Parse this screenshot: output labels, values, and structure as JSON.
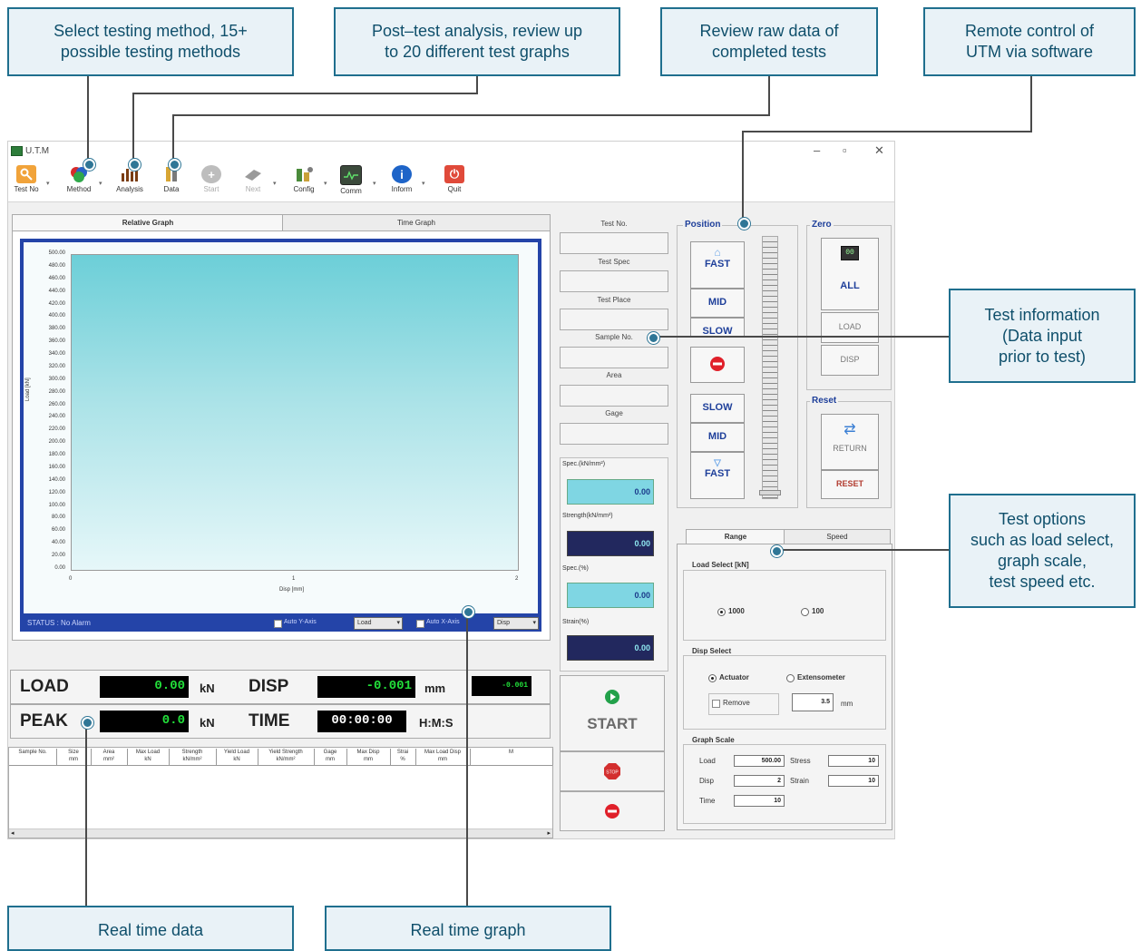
{
  "callouts": {
    "method": "Select testing method, 15+\npossible testing methods",
    "analysis": "Post–test analysis, review up\nto 20 different test graphs",
    "raw_data": "Review raw data of\ncompleted tests",
    "remote": "Remote control of\nUTM via software",
    "test_info": "Test information\n(Data input\nprior to test)",
    "test_options": "Test options\nsuch as load select,\ngraph scale,\ntest speed etc.",
    "realtime_data": "Real time data",
    "realtime_graph": "Real time graph"
  },
  "window": {
    "title": "U.T.M",
    "minimize": "–",
    "maximize": "▫",
    "close": "✕"
  },
  "toolbar": [
    {
      "label": "Test No",
      "icon": "key-icon"
    },
    {
      "label": "Method",
      "icon": "method-icon"
    },
    {
      "label": "Analysis",
      "icon": "bar-chart-icon"
    },
    {
      "label": "Data",
      "icon": "data-icon"
    },
    {
      "label": "Start",
      "icon": "plus-icon"
    },
    {
      "label": "Next",
      "icon": "arrow-icon"
    },
    {
      "label": "Config",
      "icon": "config-icon"
    },
    {
      "label": "Comm",
      "icon": "monitor-icon"
    },
    {
      "label": "Inform",
      "icon": "info-icon"
    },
    {
      "label": "Quit",
      "icon": "power-icon"
    }
  ],
  "tabs": {
    "relative": "Relative Graph",
    "time": "Time Graph"
  },
  "graph": {
    "y_axis_label": "Load [kN]",
    "x_axis_label": "Disp [mm]",
    "y_ticks": [
      "500.00",
      "480.00",
      "460.00",
      "440.00",
      "420.00",
      "400.00",
      "380.00",
      "360.00",
      "340.00",
      "320.00",
      "300.00",
      "280.00",
      "260.00",
      "240.00",
      "220.00",
      "200.00",
      "180.00",
      "160.00",
      "140.00",
      "120.00",
      "100.00",
      "80.00",
      "60.00",
      "40.00",
      "20.00",
      "0.00"
    ],
    "x_ticks": [
      "0",
      "1",
      "2"
    ],
    "status": "STATUS : No Alarm",
    "auto_y": "Auto Y-Axis",
    "y_select": "Load",
    "auto_x": "Auto X-Axis",
    "x_select": "Disp"
  },
  "readouts": {
    "load_label": "LOAD",
    "load_value": "0.00",
    "load_unit": "kN",
    "disp_label": "DISP",
    "disp_value": "-0.001",
    "disp_unit": "mm",
    "disp_small": "-0.001",
    "peak_label": "PEAK",
    "peak_value": "0.0",
    "peak_unit": "kN",
    "time_label": "TIME",
    "time_value": "00:00:00",
    "time_unit": "H:M:S"
  },
  "results_table": {
    "headers": [
      {
        "name": "Sample No.",
        "unit": ""
      },
      {
        "name": "Size",
        "unit": "mm"
      },
      {
        "name": "Area",
        "unit": "mm²"
      },
      {
        "name": "Max Load",
        "unit": "kN"
      },
      {
        "name": "Strength",
        "unit": "kN/mm²"
      },
      {
        "name": "Yield Load",
        "unit": "kN"
      },
      {
        "name": "Yield Strength",
        "unit": "kN/mm²"
      },
      {
        "name": "Gage",
        "unit": "mm"
      },
      {
        "name": "Max Disp",
        "unit": "mm"
      },
      {
        "name": "Strai",
        "unit": "%"
      },
      {
        "name": "Max Load Disp",
        "unit": "mm"
      },
      {
        "name": "M",
        "unit": ""
      }
    ]
  },
  "test_info": {
    "test_no": "Test No.",
    "test_spec": "Test Spec",
    "test_place": "Test Place",
    "sample_no": "Sample No.",
    "area": "Area",
    "gage": "Gage"
  },
  "spec_values": {
    "spec_kn_label": "Spec.(kN/mm²)",
    "spec_kn_value": "0.00",
    "strength_label": "Strength(kN/mm²)",
    "strength_value": "0.00",
    "spec_pct_label": "Spec.(%)",
    "spec_pct_value": "0.00",
    "strain_label": "Strain(%)",
    "strain_value": "0.00"
  },
  "start_panel": {
    "start_label": "START",
    "stop_label": "STOP"
  },
  "position": {
    "title": "Position",
    "up_fast": "FAST",
    "up_mid": "MID",
    "up_slow": "SLOW",
    "down_slow": "SLOW",
    "down_mid": "MID",
    "down_fast": "FAST"
  },
  "zero": {
    "title": "Zero",
    "all": "ALL",
    "load": "LOAD",
    "disp": "DISP"
  },
  "reset": {
    "title": "Reset",
    "return": "RETURN",
    "reset": "RESET"
  },
  "options": {
    "tab_range": "Range",
    "tab_speed": "Speed",
    "load_select_title": "Load Select [kN]",
    "load_1000": "1000",
    "load_100": "100",
    "disp_select_title": "Disp Select",
    "actuator": "Actuator",
    "extensometer": "Extensometer",
    "remove": "Remove",
    "remove_value": "3.5",
    "remove_unit": "mm",
    "graph_scale_title": "Graph Scale",
    "load_label": "Load",
    "load_value": "500.00",
    "stress_label": "Stress",
    "stress_value": "10",
    "disp_label": "Disp",
    "disp_value": "2",
    "strain_label": "Strain",
    "strain_value": "10",
    "time_label": "Time",
    "time_value": "10"
  },
  "colors": {
    "accent": "#1e3f9a",
    "graph_frame": "#2444a8",
    "callout_border": "#1f6f8e",
    "readout_green": "#22e03a"
  }
}
